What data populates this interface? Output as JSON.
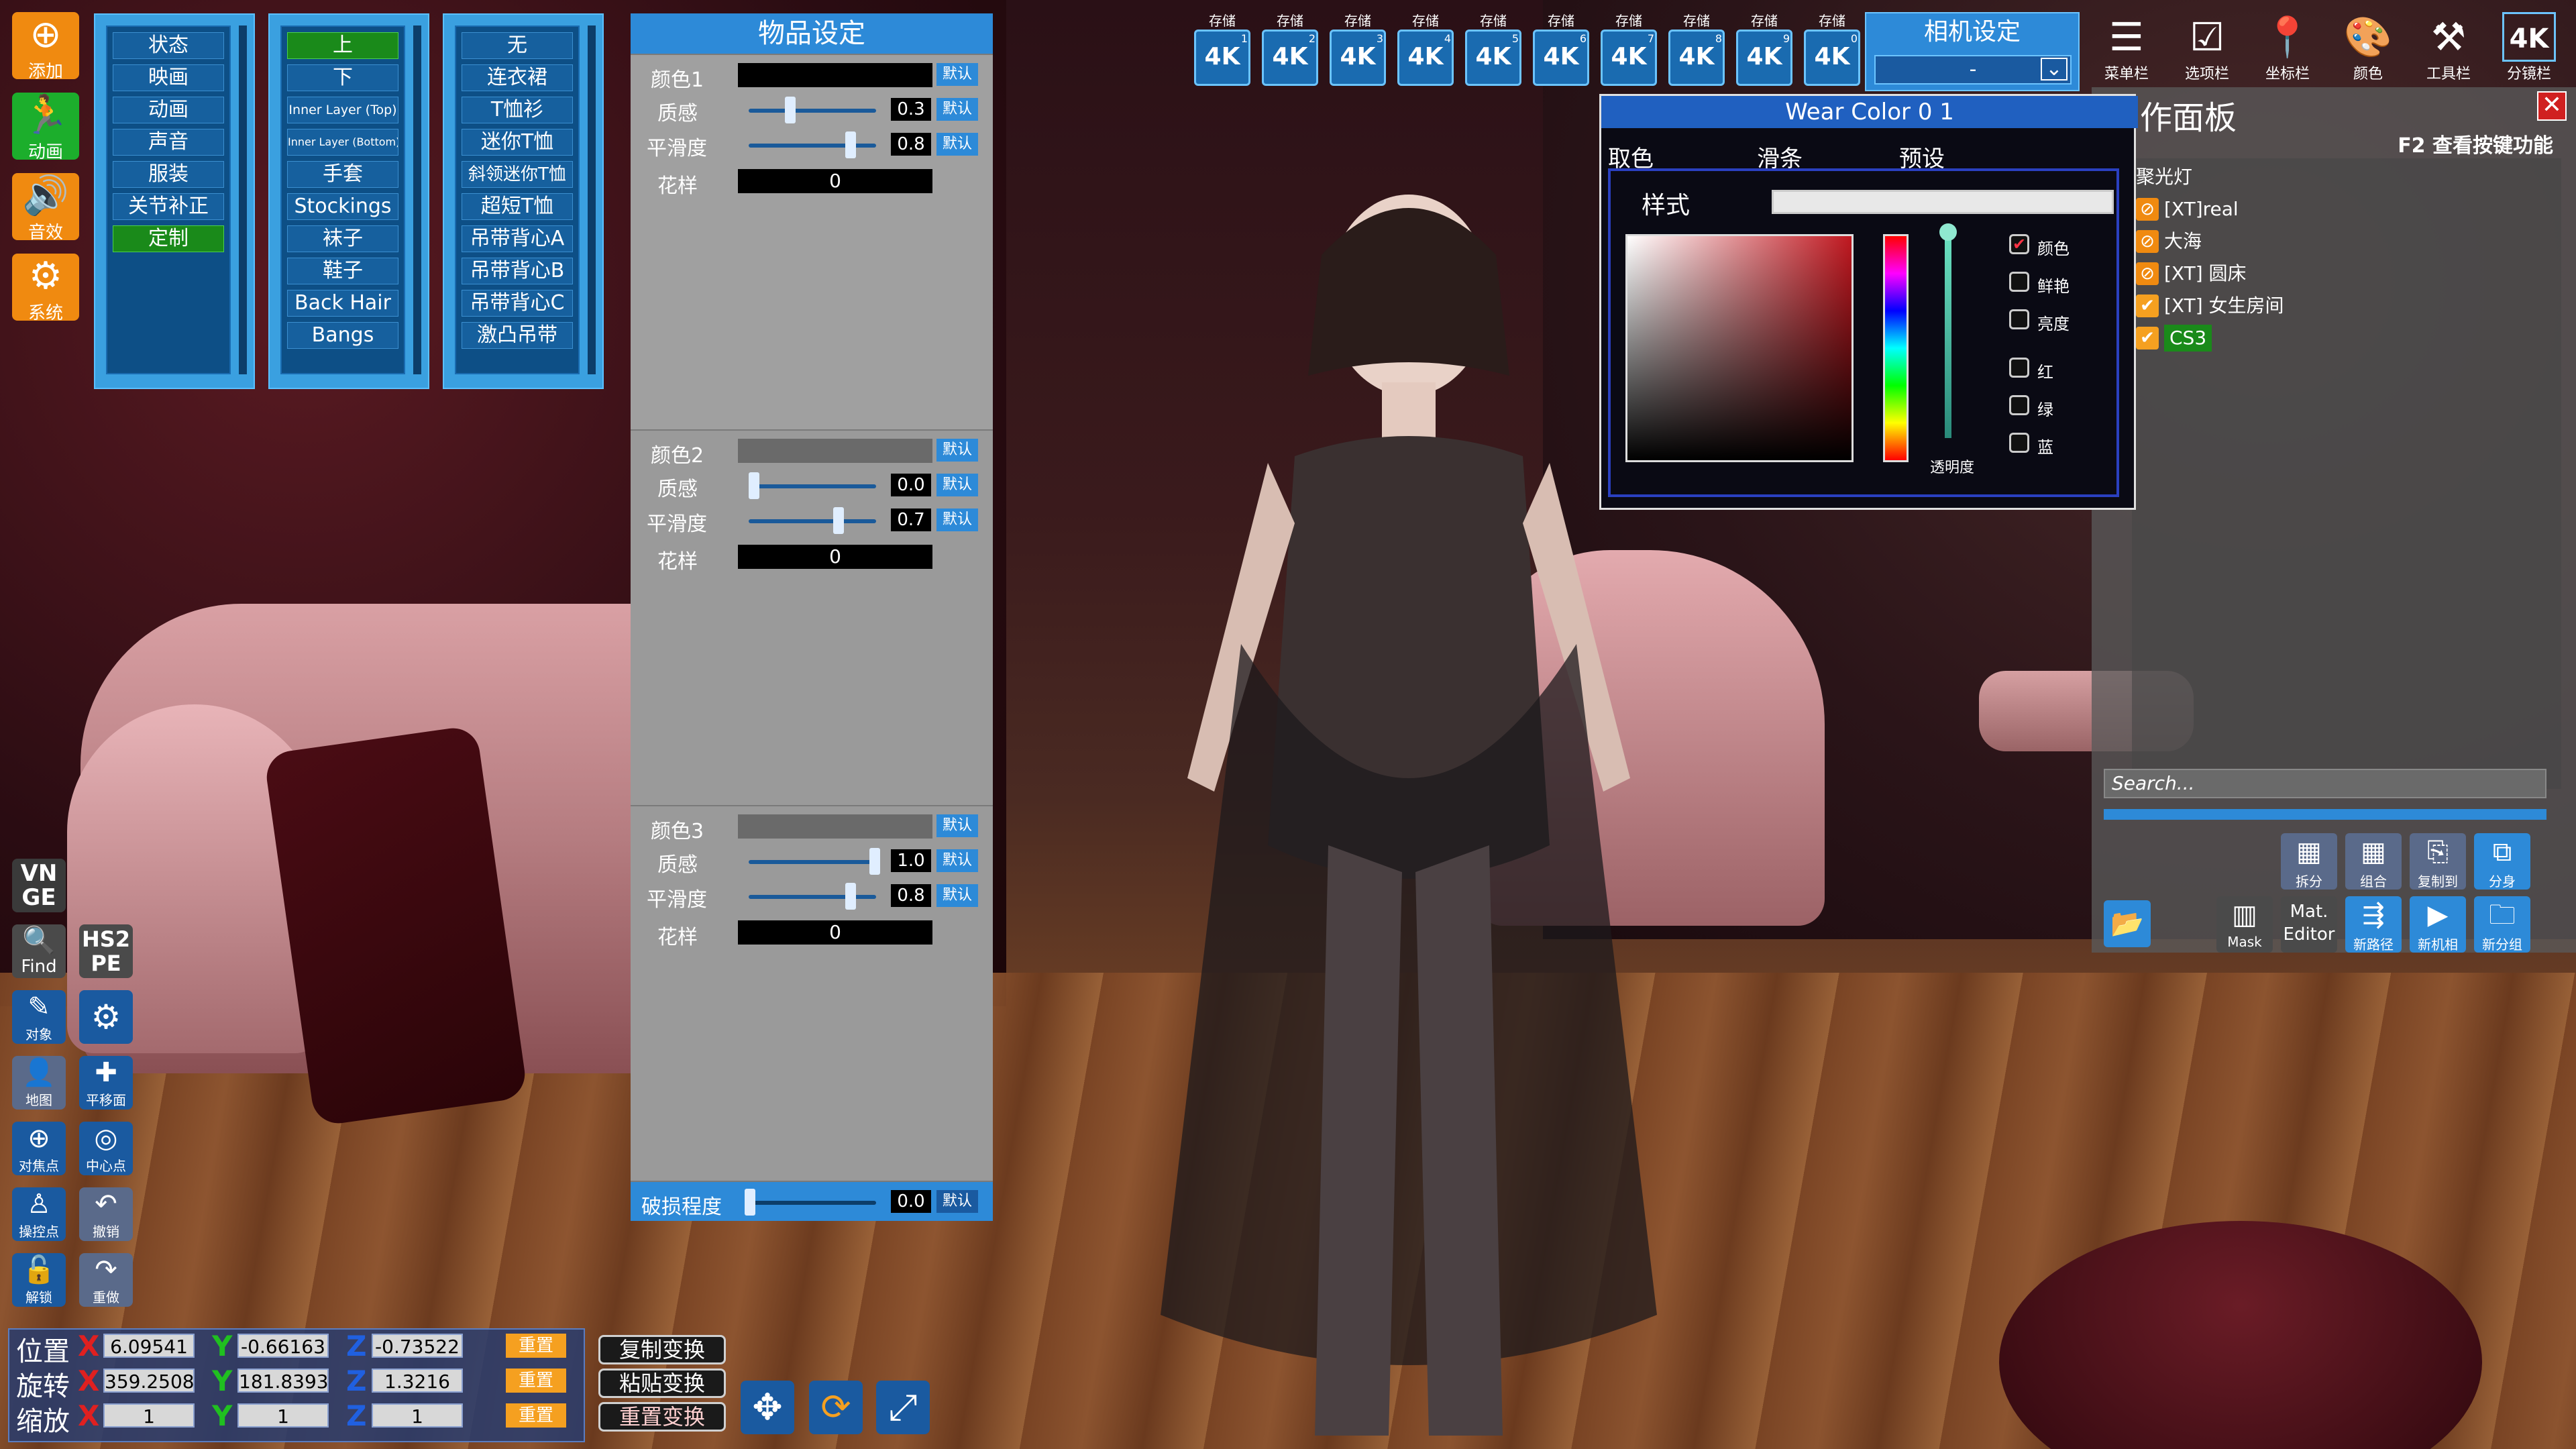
{
  "left_toolbar": {
    "add": "添加",
    "animation": "动画",
    "sound": "音效",
    "system": "系统",
    "vnge": "VN GE",
    "find": "Find",
    "hs2pe": "HS2 PE",
    "object": "对象",
    "map": "地图",
    "pan": "平移面",
    "focus": "对焦点",
    "center": "中心点",
    "control": "操控点",
    "undo": "撤销",
    "unlock": "解锁",
    "redo": "重做"
  },
  "menu1": [
    "状态",
    "映画",
    "动画",
    "声音",
    "服装",
    "关节补正",
    "定制"
  ],
  "menu2": [
    "上",
    "下",
    "Inner Layer (Top)",
    "Inner Layer (Bottom)",
    "手套",
    "Stockings",
    "袜子",
    "鞋子",
    "Back Hair",
    "Bangs"
  ],
  "menu3": [
    "无",
    "连衣裙",
    "T恤衫",
    "迷你T恤",
    "斜领迷你T恤",
    "超短T恤",
    "吊带背心A",
    "吊带背心B",
    "吊带背心C",
    "激凸吊带"
  ],
  "settings": {
    "title": "物品设定",
    "default_label": "默认",
    "texture_label": "质感",
    "smooth_label": "平滑度",
    "pattern_label": "花样",
    "groups": [
      {
        "name": "颜色1",
        "texture": 0.3,
        "texture_text": "0.3",
        "smooth": 0.8,
        "smooth_text": "0.8",
        "pattern": "0"
      },
      {
        "name": "颜色2",
        "texture": 0.0,
        "texture_text": "0.0",
        "smooth": 0.7,
        "smooth_text": "0.7",
        "pattern": "0"
      },
      {
        "name": "颜色3",
        "texture": 1.0,
        "texture_text": "1.0",
        "smooth": 0.8,
        "smooth_text": "0.8",
        "pattern": "0"
      }
    ],
    "damage_label": "破损程度",
    "damage": 0.0,
    "damage_text": "0.0"
  },
  "save_slots": {
    "save_label": "存储",
    "res_label": "4K",
    "numbers": [
      "1",
      "2",
      "3",
      "4",
      "5",
      "6",
      "7",
      "8",
      "9",
      "0"
    ]
  },
  "camera": {
    "title": "相机设定",
    "value": "-"
  },
  "tools": [
    "菜单栏",
    "选项栏",
    "坐标栏",
    "颜色",
    "工具栏",
    "分镜栏"
  ],
  "tools_4k": "4K",
  "wear_color": {
    "title": "Wear Color 0 1",
    "tabs": [
      "取色",
      "滑条",
      "预设"
    ],
    "style_label": "样式",
    "options": [
      {
        "label": "颜色",
        "checked": true
      },
      {
        "label": "鲜艳",
        "checked": false
      },
      {
        "label": "亮度",
        "checked": false
      },
      {
        "label": "红",
        "checked": false
      },
      {
        "label": "绿",
        "checked": false
      },
      {
        "label": "蓝",
        "checked": false
      }
    ],
    "alpha_label": "透明度",
    "hue_color": "#c01820"
  },
  "work_panel": {
    "title": "作面板",
    "hint": "F2 查看按键功能",
    "items": [
      {
        "label": "聚光灯",
        "state": "none"
      },
      {
        "label": "[XT]real",
        "state": "off"
      },
      {
        "label": "大海",
        "state": "off"
      },
      {
        "label": "[XT] 圆床",
        "state": "off"
      },
      {
        "label": "[XT] 女生房间",
        "state": "on"
      },
      {
        "label": "CS3",
        "state": "selected"
      }
    ],
    "search_placeholder": "Search...",
    "buttons_row1": [
      "拆分",
      "组合",
      "复制到",
      "分身"
    ],
    "buttons_row2": [
      "Mask",
      "Mat. Editor",
      "新路径",
      "新机相",
      "新分组"
    ]
  },
  "transform": {
    "position_label": "位置",
    "rotation_label": "旋转",
    "scale_label": "缩放",
    "x": "X",
    "y": "Y",
    "z": "Z",
    "position": [
      "6.09541",
      "-0.66163",
      "-0.73522"
    ],
    "rotation": [
      "359.2508",
      "181.8393",
      "1.3216"
    ],
    "scale": [
      "1",
      "1",
      "1"
    ],
    "reset_label": "重置",
    "copy": "复制变换",
    "paste": "粘贴变换",
    "reset_xf": "重置变换"
  },
  "colors": {
    "accent": "#2d8ad8",
    "selected_green": "#1a8a1a",
    "orange": "#f5a020"
  }
}
